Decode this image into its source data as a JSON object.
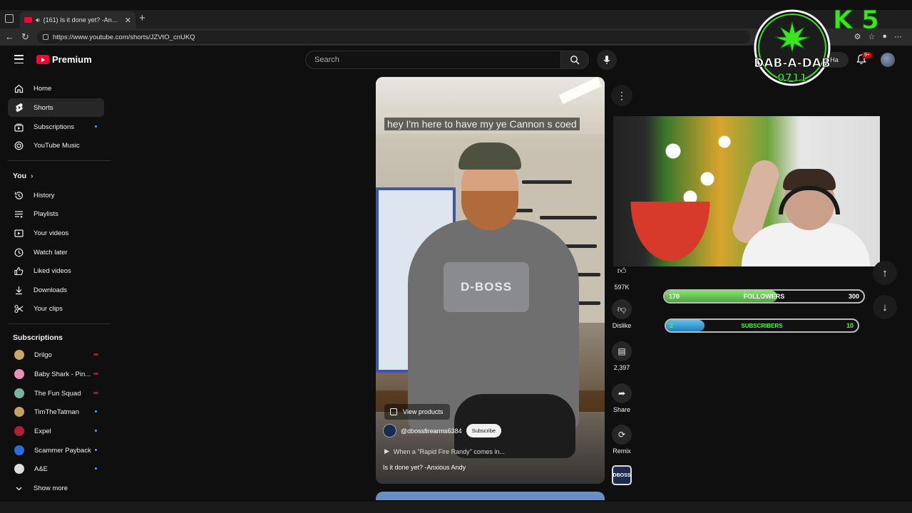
{
  "browser": {
    "tab_title": "(161) Is it done yet? -Anxiou...",
    "url": "https://www.youtube.com/shorts/JZVtO_cnUKQ"
  },
  "header": {
    "logo_text": "Premium",
    "search_placeholder": "Search",
    "create_label": "Ha",
    "notification_count": "9+"
  },
  "sidebar": {
    "main": [
      {
        "label": "Home",
        "icon": "home-icon"
      },
      {
        "label": "Shorts",
        "icon": "shorts-icon"
      },
      {
        "label": "Subscriptions",
        "icon": "subscriptions-icon"
      },
      {
        "label": "YouTube Music",
        "icon": "music-icon"
      }
    ],
    "you_title": "You",
    "you": [
      {
        "label": "History",
        "icon": "history-icon"
      },
      {
        "label": "Playlists",
        "icon": "playlists-icon"
      },
      {
        "label": "Your videos",
        "icon": "your-videos-icon"
      },
      {
        "label": "Watch later",
        "icon": "watch-later-icon"
      },
      {
        "label": "Liked videos",
        "icon": "like-icon"
      },
      {
        "label": "Downloads",
        "icon": "download-icon"
      },
      {
        "label": "Your clips",
        "icon": "clips-icon"
      }
    ],
    "subs_title": "Subscriptions",
    "subscriptions": [
      {
        "label": "Drilgo",
        "color": "#c9a86a"
      },
      {
        "label": "Baby Shark - Pin...",
        "color": "#e88fb8"
      },
      {
        "label": "The Fun Squad",
        "color": "#7bb3a0"
      },
      {
        "label": "TimTheTatman",
        "color": "#c8a060"
      },
      {
        "label": "Expel",
        "color": "#b0203a"
      },
      {
        "label": "Scammer Payback",
        "color": "#2f6ad8"
      },
      {
        "label": "A&E",
        "color": "#dddddd"
      }
    ],
    "show_more": "Show more"
  },
  "short": {
    "caption": "hey I'm here to have my ye Cannon s coed",
    "shirt_text": "D-BOSS",
    "view_products": "View products",
    "channel": "@dbossfirearms6384",
    "subscribe": "Subscribe",
    "linked_video": "When a \"Rapid Fire Randy\" comes in...",
    "title": "Is it done yet? -Anxious Andy"
  },
  "actions": {
    "likes": "597K",
    "dislike": "Dislike",
    "comments": "2,397",
    "share": "Share",
    "remix": "Remix",
    "audio_thumb": "DBOSS"
  },
  "overlay": {
    "followers": {
      "current": "170",
      "label": "FOLLOWERS",
      "goal": "300",
      "progress": 0.567
    },
    "subscribers": {
      "current": "2",
      "label": "SUBSCRIBERS",
      "goal": "10",
      "progress": 0.2
    },
    "logo_top": "DAB-A-DAB",
    "logo_bottom": "0711",
    "k5": "K5"
  },
  "colors": {
    "brand_red": "#ff0033",
    "followers_fill": "#5cc24a",
    "subscribers_fill": "#2a9fd6",
    "subscribers_text": "#3cff2a"
  }
}
